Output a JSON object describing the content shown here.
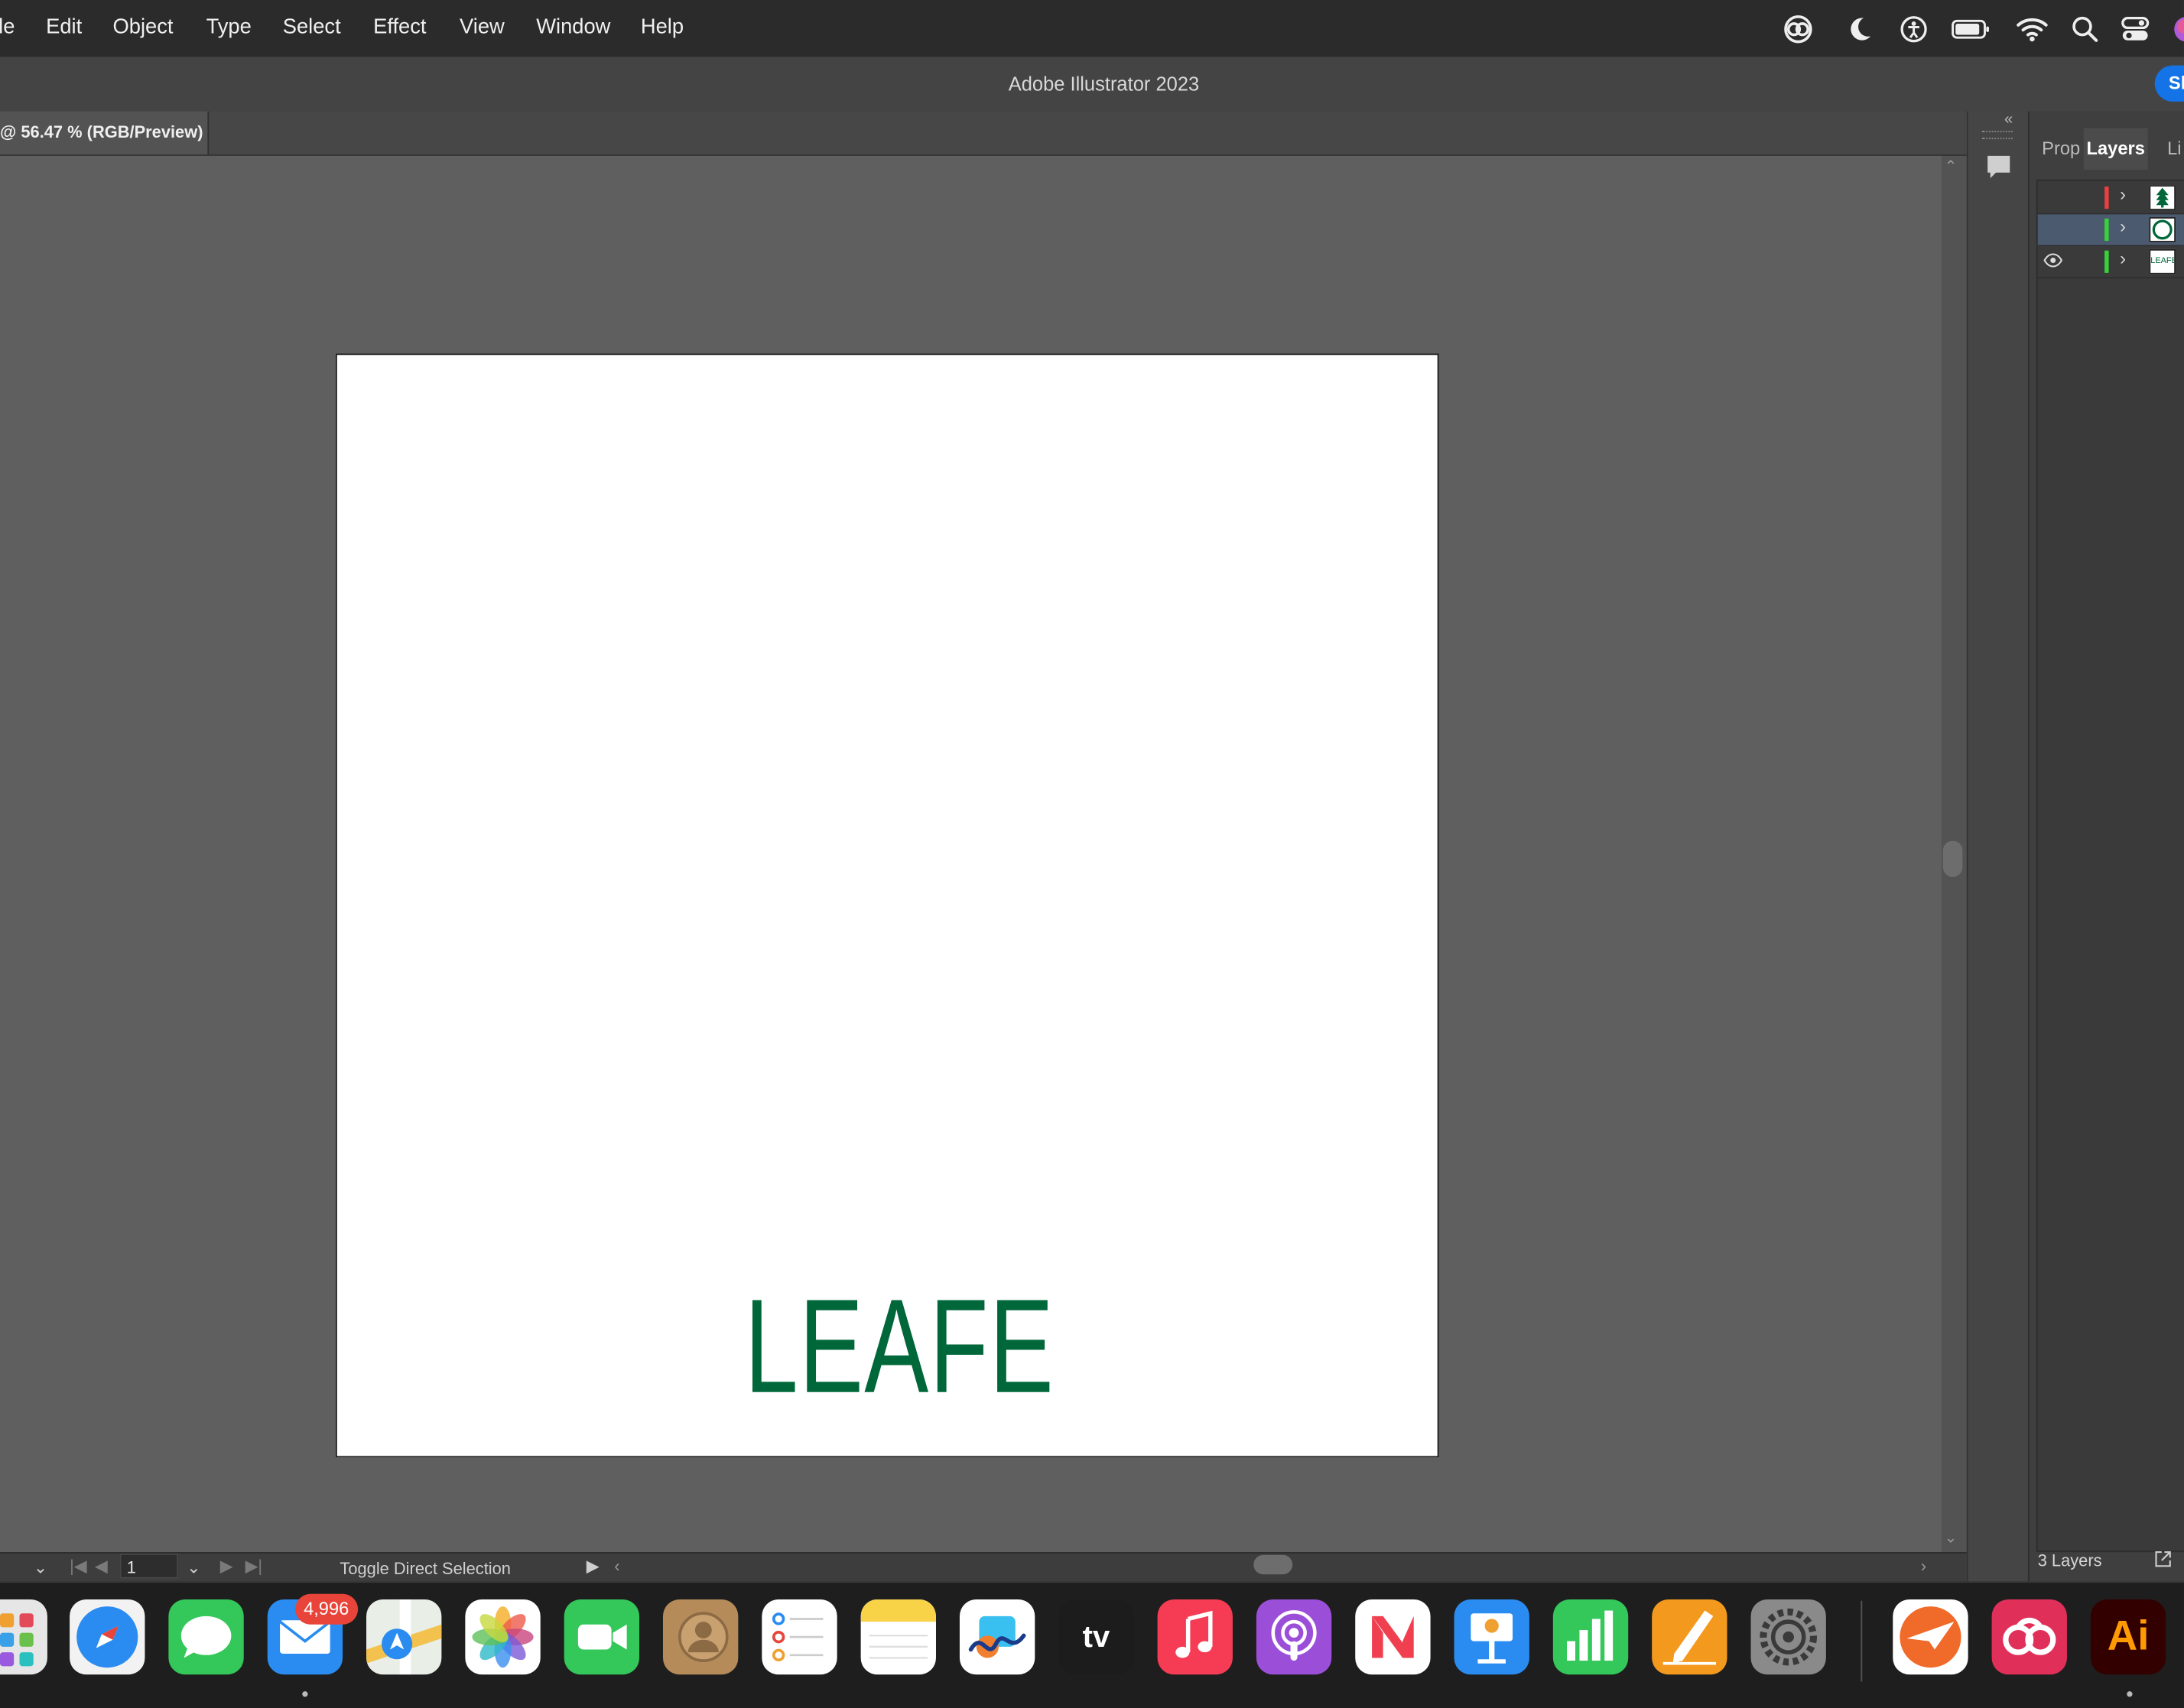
{
  "menubar": {
    "items": [
      "le",
      "Edit",
      "Object",
      "Type",
      "Select",
      "Effect",
      "View",
      "Window",
      "Help"
    ]
  },
  "window": {
    "title": "Adobe Illustrator 2023",
    "share_label": "Sh"
  },
  "document": {
    "tab_label": "@ 56.47 % (RGB/Preview)"
  },
  "artboard": {
    "text": "LEAFE",
    "text_color": "#00673a"
  },
  "statusbar": {
    "page_value": "1",
    "status_text": "Toggle Direct Selection"
  },
  "layers_panel": {
    "tabs": [
      "Prop",
      "Layers",
      "Li"
    ],
    "active_tab": "Layers",
    "layers": [
      {
        "color": "#e84040",
        "visible": false,
        "selected": false,
        "thumb": "tree-thumbnail"
      },
      {
        "color": "#37d23a",
        "visible": false,
        "selected": true,
        "thumb": "circle-thumbnail"
      },
      {
        "color": "#37d23a",
        "visible": true,
        "selected": false,
        "thumb": "text-thumbnail",
        "thumb_text": "LEAFE"
      }
    ],
    "footer": "3 Layers"
  },
  "dock": {
    "mail_badge": "4,996",
    "illustrator_label": "Ai",
    "appletv_label": "tv",
    "apps": [
      "launchpad",
      "safari",
      "messages",
      "mail",
      "maps",
      "photos",
      "facetime",
      "contacts",
      "reminders",
      "notes",
      "freeform",
      "apple-tv",
      "music",
      "podcasts",
      "news",
      "keynote",
      "numbers",
      "pages",
      "system-settings",
      "airmail",
      "creative-cloud",
      "illustrator"
    ]
  },
  "colors": {
    "accent": "#1473e6",
    "canvas": "#5f5f5f",
    "badge": "#e8443a"
  }
}
